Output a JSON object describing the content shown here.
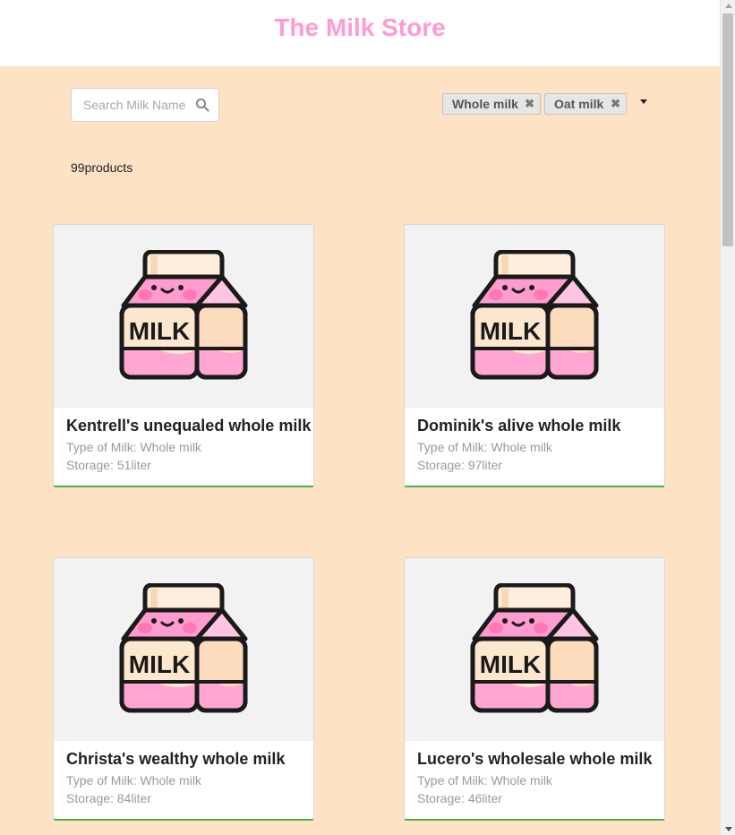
{
  "header": {
    "title": "The Milk Store"
  },
  "search": {
    "placeholder": "Search Milk Name",
    "value": ""
  },
  "filters": {
    "chips": [
      "Whole milk",
      "Oat milk"
    ],
    "remove_glyph": "✖"
  },
  "results": {
    "count_text": "99products"
  },
  "products": [
    {
      "name": "Kentrell's unequaled whole milk",
      "type": "Type of Milk: Whole milk",
      "storage": "Storage: 51liter"
    },
    {
      "name": "Dominik's alive whole milk",
      "type": "Type of Milk: Whole milk",
      "storage": "Storage: 97liter"
    },
    {
      "name": "Christa's wealthy whole milk",
      "type": "Type of Milk: Whole milk",
      "storage": "Storage: 84liter"
    },
    {
      "name": "Lucero's wholesale whole milk",
      "type": "Type of Milk: Whole milk",
      "storage": "Storage: 46liter"
    }
  ],
  "product_image": {
    "label": "MILK",
    "icon": "milk-carton-icon"
  },
  "colors": {
    "brand": "#ff9ad5",
    "background": "#fde2c3",
    "card_accent": "#4caf50"
  }
}
